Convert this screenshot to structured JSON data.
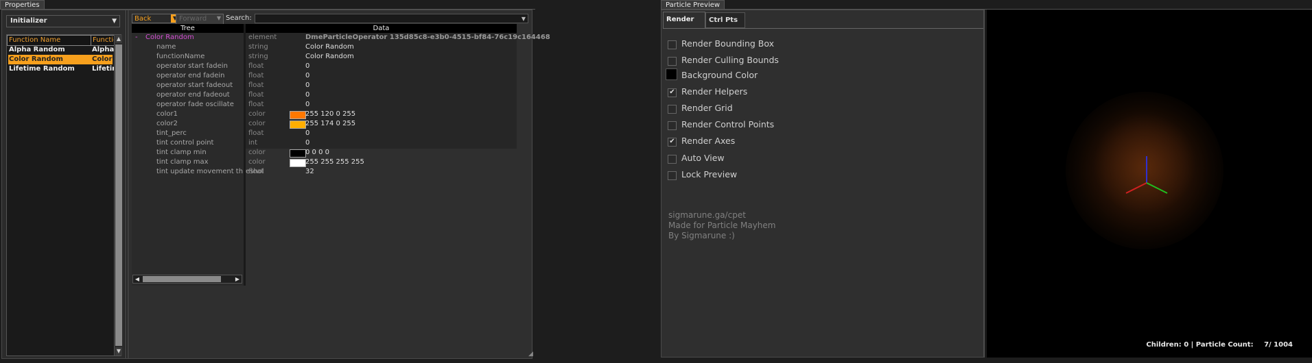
{
  "properties_panel": {
    "tab_title": "Properties",
    "category_combo": "Initializer",
    "function_list": {
      "headers": [
        "Function Name",
        "Function Ty..."
      ],
      "rows": [
        {
          "name": "Alpha Random",
          "type": "Alpha Ran..",
          "selected": false
        },
        {
          "name": "Color Random",
          "type": "Color Rand..",
          "selected": true
        },
        {
          "name": "Lifetime Random",
          "type": "Lifetime R..",
          "selected": false
        }
      ]
    },
    "toolbar": {
      "back_label": "Back",
      "forward_label": "Forward",
      "search_label": "Search:",
      "search_value": ""
    },
    "tree": {
      "tree_header": "Tree",
      "data_header": "Data",
      "root": {
        "collapse": "-",
        "label": "Color Random",
        "type": "element",
        "value": "DmeParticleOperator 135d85c8-e3b0-4515-bf84-76c19c164468"
      },
      "rows": [
        {
          "label": "name",
          "type": "string",
          "value": "Color Random"
        },
        {
          "label": "functionName",
          "type": "string",
          "value": "Color Random"
        },
        {
          "label": "operator start fadein",
          "type": "float",
          "value": "0"
        },
        {
          "label": "operator end fadein",
          "type": "float",
          "value": "0"
        },
        {
          "label": "operator start fadeout",
          "type": "float",
          "value": "0"
        },
        {
          "label": "operator end fadeout",
          "type": "float",
          "value": "0"
        },
        {
          "label": "operator fade oscillate",
          "type": "float",
          "value": "0"
        },
        {
          "label": "color1",
          "type": "color",
          "value": "255 120 0 255",
          "swatch": "#ff7800"
        },
        {
          "label": "color2",
          "type": "color",
          "value": "255 174 0 255",
          "swatch": "#ffae00"
        },
        {
          "label": "tint_perc",
          "type": "float",
          "value": "0"
        },
        {
          "label": "tint control point",
          "type": "int",
          "value": "0"
        },
        {
          "label": "tint clamp min",
          "type": "color",
          "value": "0 0 0 0",
          "swatch": "#000000"
        },
        {
          "label": "tint clamp max",
          "type": "color",
          "value": "255 255 255 255",
          "swatch": "#ffffff"
        },
        {
          "label": "tint update movement threshol",
          "type": "float",
          "value": "32"
        }
      ]
    }
  },
  "preview_panel": {
    "tab_title": "Particle Preview",
    "tabs": [
      {
        "label": "Render",
        "active": true
      },
      {
        "label": "Ctrl Pts",
        "active": false
      }
    ],
    "options": [
      {
        "label": "Render Bounding Box",
        "checked": false
      },
      {
        "label": "Render Culling Bounds",
        "checked": false
      },
      {
        "label": "Background Color",
        "checked": false,
        "color_swatch": "#000000"
      },
      {
        "label": "Render Helpers",
        "checked": true
      },
      {
        "label": "Render Grid",
        "checked": false
      },
      {
        "label": "Render Control Points",
        "checked": false
      },
      {
        "label": "Render Axes",
        "checked": true
      },
      {
        "label": "Auto View",
        "checked": false
      },
      {
        "label": "Lock Preview",
        "checked": false
      }
    ],
    "credits": [
      "sigmarune.ga/cpet",
      "Made for Particle Mayhem",
      "By Sigmarune :)"
    ],
    "status": {
      "children_label": "Children:",
      "children_value": "0",
      "separator": "|",
      "count_label": "Particle Count:",
      "count_value": "7/ 1004"
    },
    "colors": {
      "accent": "#f7a01d",
      "root_label": "#d44fd4",
      "axis_x": "#d02020",
      "axis_y": "#20c020",
      "axis_z": "#3030d0"
    }
  }
}
